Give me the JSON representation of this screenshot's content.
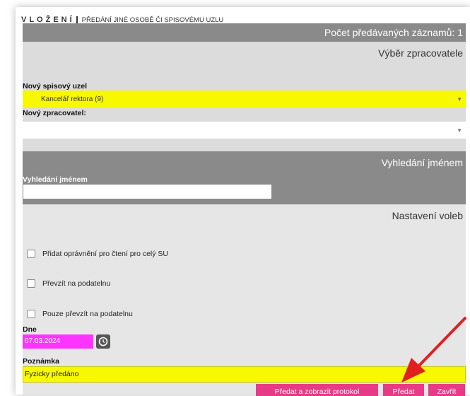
{
  "header": {
    "title_main": "VLOŽENÍ",
    "title_sub": "PŘEDÁNÍ JINÉ OSOBĚ ČI SPISOVÉMU UZLU"
  },
  "record_count": "Počet předávaných záznamů: 1",
  "processor_section": {
    "heading": "Výběr zpracovatele",
    "new_node_label": "Nový spisový uzel",
    "new_node_value": "Kancelář rektora (9)",
    "new_processor_label": "Nový zpracovatel:",
    "new_processor_value": ""
  },
  "name_search": {
    "heading": "Vyhledání jménem",
    "label": "Vyhledání jménem",
    "value": ""
  },
  "options": {
    "heading": "Nastavení voleb",
    "checkboxes": [
      {
        "label": "Přidat oprávnění pro čtení pro celý SU",
        "checked": false
      },
      {
        "label": "Převzít na podatelnu",
        "checked": false
      },
      {
        "label": "Pouze převzít na podatelnu",
        "checked": false
      }
    ],
    "date_label": "Dne",
    "date_value": "07.03.2024",
    "note_label": "Poznámka",
    "note_value": "Fyzicky předáno"
  },
  "buttons": {
    "submit_protocol": "Předat a zobrazit protokol",
    "submit": "Předat",
    "close": "Zavřít"
  },
  "colors": {
    "accent": "#e83b87",
    "highlight": "#f8f800",
    "header_gray": "#8a8a8a",
    "date_field": "#ff33ff",
    "annotation_arrow": "#e02020"
  }
}
